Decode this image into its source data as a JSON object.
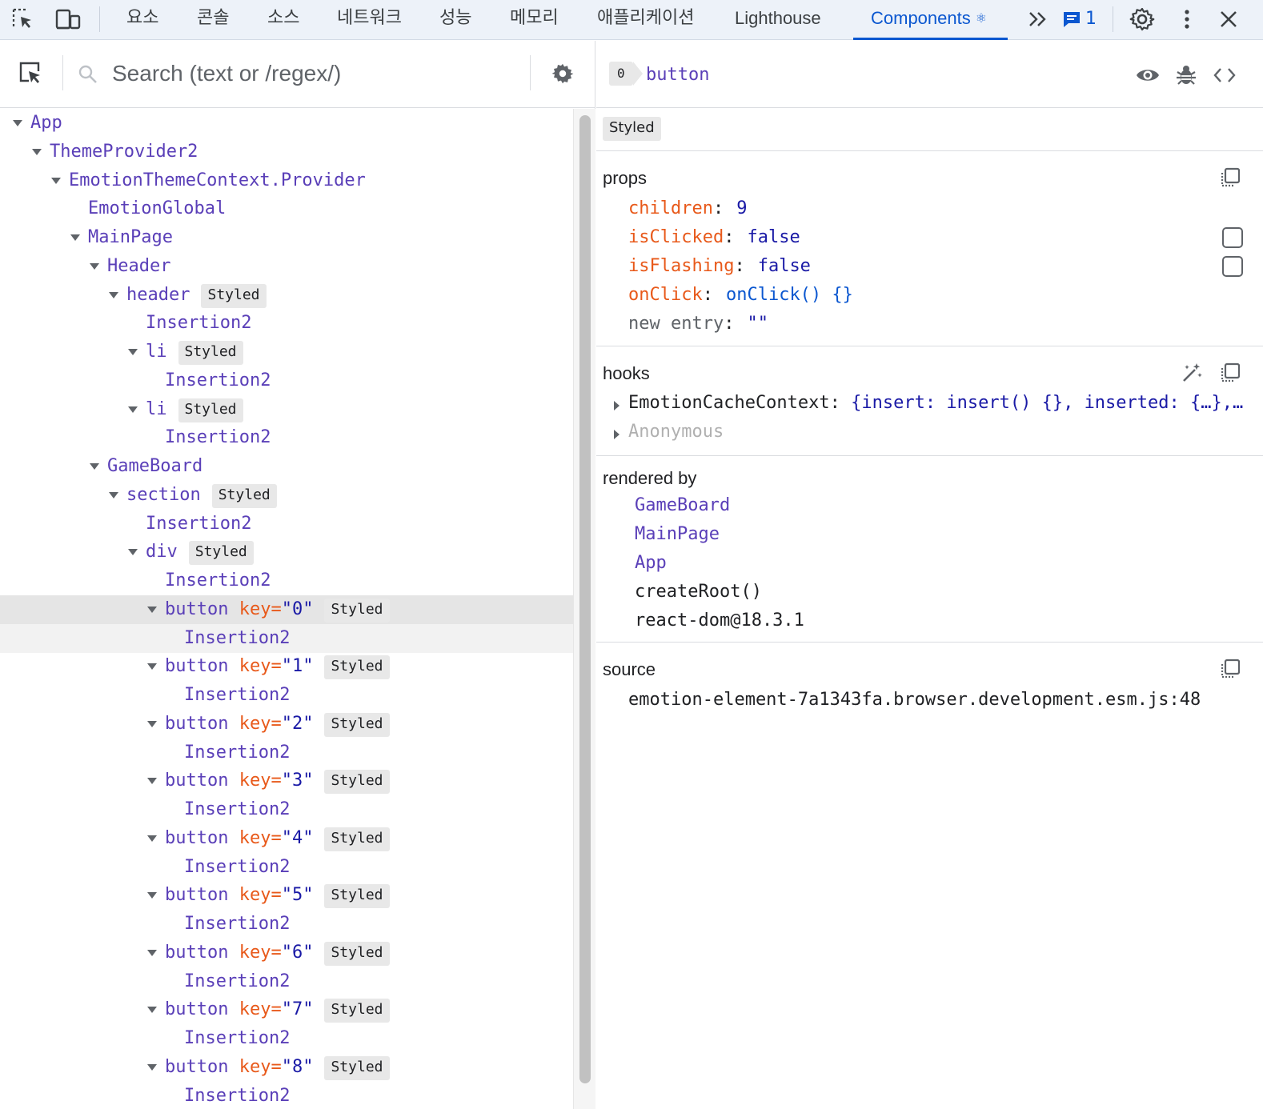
{
  "toolbar": {
    "tabs": [
      {
        "label": "요소"
      },
      {
        "label": "콘솔"
      },
      {
        "label": "소스"
      },
      {
        "label": "네트워크"
      },
      {
        "label": "성능"
      },
      {
        "label": "메모리"
      },
      {
        "label": "애플리케이션"
      },
      {
        "label": "Lighthouse"
      },
      {
        "label": "Components",
        "active": true,
        "icon": "react-icon"
      }
    ],
    "message_count": "1",
    "icons": [
      "inspect-element-icon",
      "device-toggle-icon",
      "more-tabs-icon",
      "issues-icon",
      "settings-icon",
      "kebab-menu-icon",
      "close-icon"
    ]
  },
  "search": {
    "placeholder": "Search (text or /regex/)",
    "value": ""
  },
  "tree": {
    "badge_label": "Styled",
    "key_attr": "key=",
    "rows": [
      {
        "name": "App"
      },
      {
        "name": "ThemeProvider2"
      },
      {
        "name": "EmotionThemeContext.Provider"
      },
      {
        "name": "EmotionGlobal"
      },
      {
        "name": "MainPage"
      },
      {
        "name": "Header"
      },
      {
        "name": "header"
      },
      {
        "name": "Insertion2"
      },
      {
        "name": "li"
      },
      {
        "name": "Insertion2"
      },
      {
        "name": "li"
      },
      {
        "name": "Insertion2"
      },
      {
        "name": "GameBoard"
      },
      {
        "name": "section"
      },
      {
        "name": "Insertion2"
      },
      {
        "name": "div"
      },
      {
        "name": "Insertion2"
      },
      {
        "name": "button",
        "key": "\"0\""
      },
      {
        "name": "Insertion2"
      },
      {
        "name": "button",
        "key": "\"1\""
      },
      {
        "name": "Insertion2"
      },
      {
        "name": "button",
        "key": "\"2\""
      },
      {
        "name": "Insertion2"
      },
      {
        "name": "button",
        "key": "\"3\""
      },
      {
        "name": "Insertion2"
      },
      {
        "name": "button",
        "key": "\"4\""
      },
      {
        "name": "Insertion2"
      },
      {
        "name": "button",
        "key": "\"5\""
      },
      {
        "name": "Insertion2"
      },
      {
        "name": "button",
        "key": "\"6\""
      },
      {
        "name": "Insertion2"
      },
      {
        "name": "button",
        "key": "\"7\""
      },
      {
        "name": "Insertion2"
      },
      {
        "name": "button",
        "key": "\"8\""
      },
      {
        "name": "Insertion2"
      }
    ]
  },
  "inspector": {
    "id_badge": "0",
    "selected_name": "button",
    "badge_label": "Styled",
    "props": {
      "title": "props",
      "items": [
        {
          "name": "children",
          "value": "9"
        },
        {
          "name": "isClicked",
          "value": "false",
          "checked": false
        },
        {
          "name": "isFlashing",
          "value": "false",
          "checked": false
        },
        {
          "name": "onClick",
          "value": "onClick() {}"
        }
      ],
      "new_entry_name": "new entry",
      "new_entry_value": "\"\""
    },
    "hooks": {
      "title": "hooks",
      "items": [
        {
          "name": "EmotionCacheContext",
          "value": "{insert: insert() {}, inserted: {…},…"
        },
        {
          "name": "Anonymous",
          "value": ""
        }
      ]
    },
    "rendered_by": {
      "title": "rendered by",
      "owners": [
        "GameBoard",
        "MainPage",
        "App"
      ],
      "extra": [
        "createRoot()",
        "react-dom@18.3.1"
      ]
    },
    "source": {
      "title": "source",
      "file": "emotion-element-7a1343fa.browser.development.esm.js:48"
    }
  },
  "colors": {
    "accent": "#0b57d0",
    "component_name": "#5a3fb8",
    "prop_name": "#e8591a",
    "value": "#1a1aa6",
    "selected_row": "#e5e5e5"
  }
}
